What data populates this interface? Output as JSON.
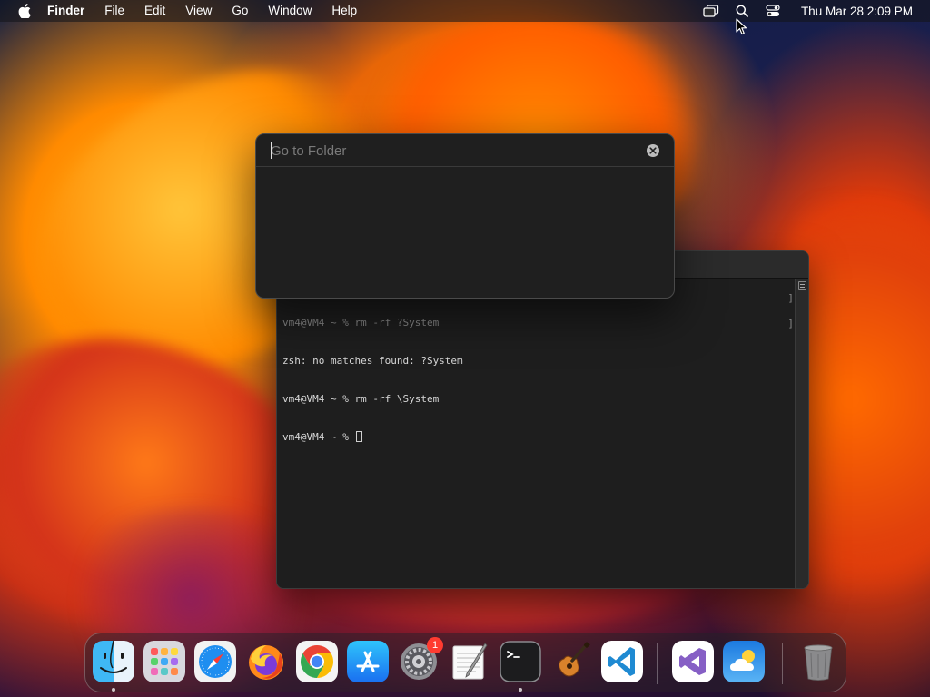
{
  "menubar": {
    "app_name": "Finder",
    "menus": [
      "File",
      "Edit",
      "View",
      "Go",
      "Window",
      "Help"
    ],
    "clock": "Thu Mar 28  2:09 PM",
    "icons": [
      "apple-icon",
      "screen-mirroring-icon",
      "spotlight-search-icon",
      "control-center-icon"
    ]
  },
  "go_to_folder": {
    "placeholder": "Go to Folder",
    "value": "",
    "clear_icon": "close-circle-icon"
  },
  "terminal": {
    "lines": [
      "vm4@VM4 ~ % rm -rf ?System",
      "zsh: no matches found: ?System",
      "vm4@VM4 ~ % rm -rf \\System",
      "vm4@VM4 ~ % "
    ]
  },
  "dock": {
    "items": [
      {
        "name": "Finder",
        "icon": "finder-icon",
        "running": true
      },
      {
        "name": "Launchpad",
        "icon": "launchpad-icon",
        "running": false
      },
      {
        "name": "Safari",
        "icon": "safari-icon",
        "running": false
      },
      {
        "name": "Firefox",
        "icon": "firefox-icon",
        "running": false
      },
      {
        "name": "Google Chrome",
        "icon": "chrome-icon",
        "running": false
      },
      {
        "name": "App Store",
        "icon": "app-store-icon",
        "running": false
      },
      {
        "name": "System Preferences",
        "icon": "system-preferences-icon",
        "running": false,
        "badge": "1"
      },
      {
        "name": "TextEdit",
        "icon": "textedit-icon",
        "running": false
      },
      {
        "name": "Terminal",
        "icon": "terminal-icon",
        "running": true
      },
      {
        "name": "GarageBand",
        "icon": "garageband-icon",
        "running": false
      },
      {
        "name": "Visual Studio Code",
        "icon": "vscode-icon",
        "running": false
      },
      {
        "name": "Visual Studio",
        "icon": "visual-studio-icon",
        "running": false
      },
      {
        "name": "Weather",
        "icon": "weather-icon",
        "running": false
      },
      {
        "name": "Trash",
        "icon": "trash-icon",
        "running": false
      }
    ]
  },
  "colors": {
    "menubar_bg": "#141418",
    "terminal_bg": "#1e1e1e",
    "panel_bg": "#1f1f1f",
    "badge_red": "#ff3b30"
  }
}
